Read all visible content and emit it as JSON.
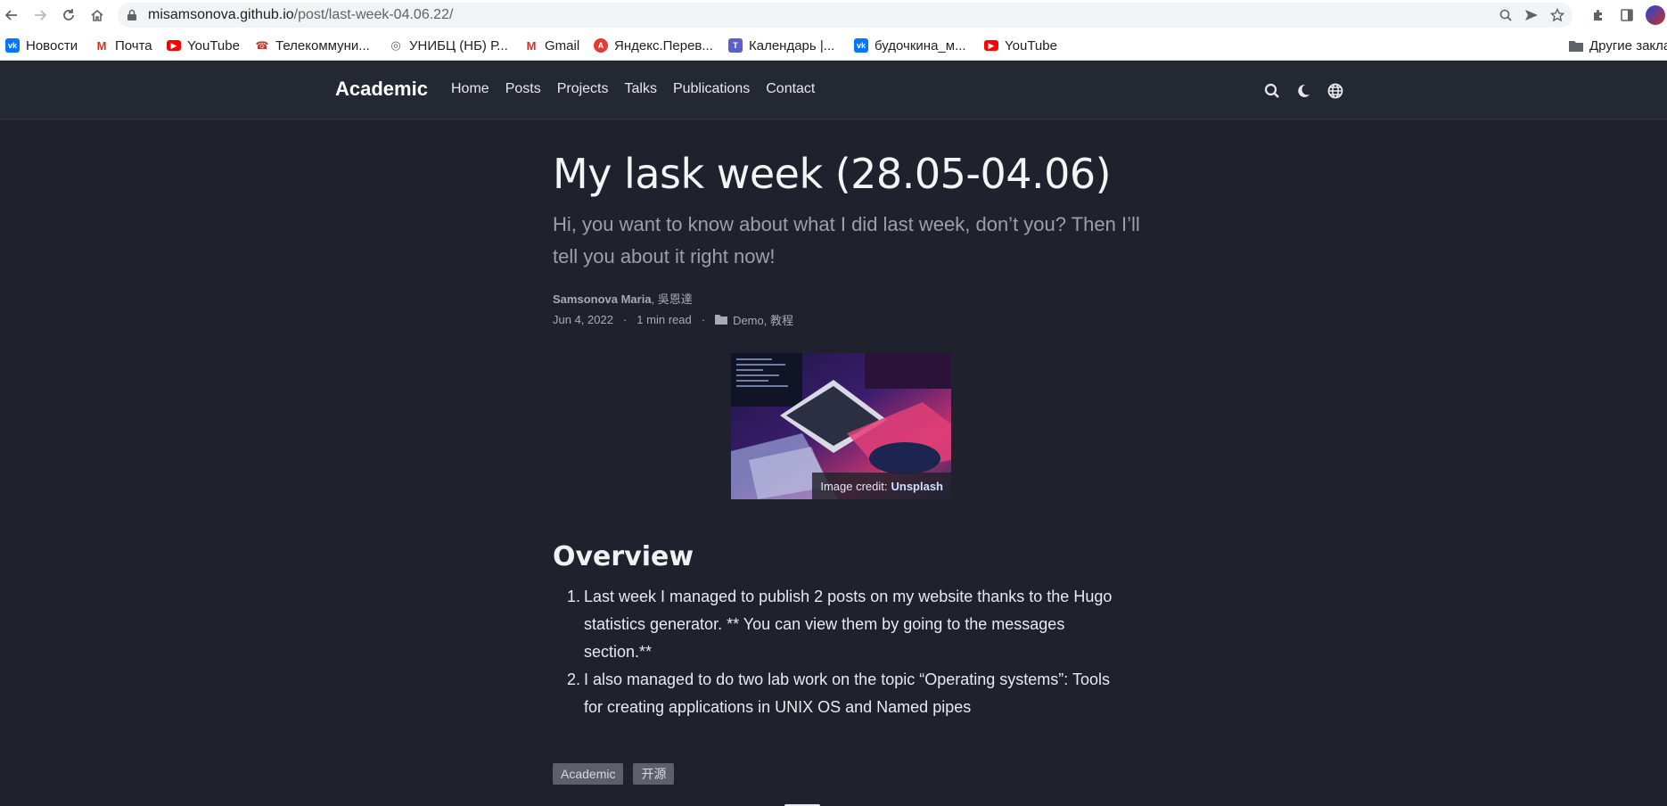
{
  "browser": {
    "url_host": "misamsonova.github.io",
    "url_path": "/post/last-week-04.06.22/",
    "nav_icons": [
      "back-arrow-icon",
      "forward-arrow-icon",
      "reload-icon",
      "home-icon"
    ],
    "omnibox_icons": [
      "zoom-icon",
      "send-icon",
      "bookmark-star-icon"
    ],
    "toolbar_icons": [
      "extensions-puzzle-icon",
      "side-panel-icon",
      "profile-avatar"
    ]
  },
  "bookmarks": {
    "items": [
      {
        "label": "Новости",
        "icon": "vk-icon",
        "color": "#0077ff"
      },
      {
        "label": "Почта",
        "icon": "gmail-icon",
        "color": "#d93025"
      },
      {
        "label": "YouTube",
        "icon": "youtube-icon",
        "color": "#ff0000"
      },
      {
        "label": "Телекоммуни...",
        "icon": "telecom-icon",
        "color": "#c0392b"
      },
      {
        "label": "УНИБЦ (НБ) Р...",
        "icon": "globe-icon",
        "color": "#5f6368"
      },
      {
        "label": "Gmail",
        "icon": "gmail-icon",
        "color": "#d93025"
      },
      {
        "label": "Яндекс.Перев...",
        "icon": "yandex-translate-icon",
        "color": "#e53935"
      },
      {
        "label": "Календарь |...",
        "icon": "teams-icon",
        "color": "#5b5fc7"
      },
      {
        "label": "будочкина_м...",
        "icon": "vk-icon",
        "color": "#0077ff"
      },
      {
        "label": "YouTube",
        "icon": "youtube-icon",
        "color": "#ff0000"
      }
    ],
    "other": "Другие закла"
  },
  "header": {
    "brand": "Academic",
    "menu": [
      "Home",
      "Posts",
      "Projects",
      "Talks",
      "Publications",
      "Contact"
    ],
    "icons": [
      "search-icon",
      "dark-mode-moon-icon",
      "language-globe-icon"
    ]
  },
  "article": {
    "title": "My lask week (28.05-04.06)",
    "summary": "Hi, you want to know about what I did last week, don’t you? Then I’ll tell you about it right now!",
    "author_primary": "Samsonova Maria",
    "author_secondary": ", 吳恩達",
    "date": "Jun 4, 2022",
    "separator": "·",
    "read_time": "1 min read",
    "categories": "Demo, 教程",
    "image_credit_prefix": "Image credit:",
    "image_credit_link": "Unsplash",
    "section_heading": "Overview",
    "list": [
      {
        "num": "1.",
        "text": "Last week I managed to publish 2 posts on my website thanks to the Hugo statistics generator. ** You can view them by going to the messages section.**"
      },
      {
        "num": "2.",
        "text": "I also managed to do two lab work on the topic “Operating systems”: Tools for creating applications in UNIX OS and Named pipes"
      }
    ],
    "tags": [
      "Academic",
      "开源"
    ]
  },
  "colors": {
    "page_bg": "#1f222c",
    "header_bg": "#242832",
    "text": "#f3f4f6",
    "muted": "#9aa0aa",
    "tag_bg": "#5d6068"
  }
}
